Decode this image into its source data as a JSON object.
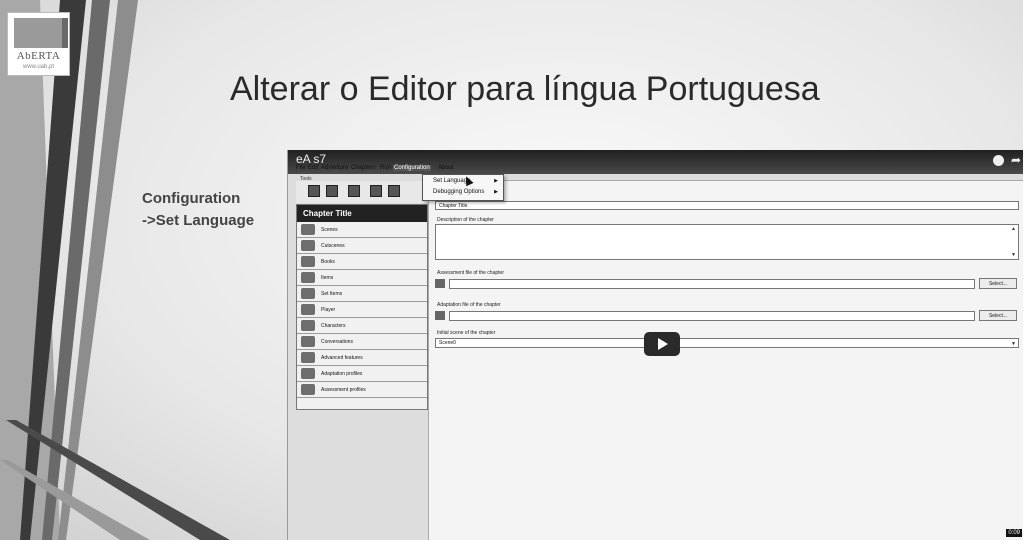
{
  "slide": {
    "title": "Alterar o Editor para língua Portuguesa",
    "steps": [
      "Configuration",
      "->Set Language"
    ]
  },
  "logo": {
    "name": "AbERTA",
    "subtitle": "www.uab.pt"
  },
  "video": {
    "title": "eA s7",
    "duration": "0:09",
    "icons": [
      "clock-icon",
      "share-icon",
      "play-icon"
    ]
  },
  "app": {
    "menu": [
      "File",
      "Edit",
      "Adventure",
      "Chapters",
      "Run",
      "Configuration",
      "About"
    ],
    "menu_selected": "Configuration",
    "dropdown": [
      "Set Language",
      "Debugging Options"
    ],
    "tools_label": "Tools",
    "panel_title": "Chapter Title",
    "nav_items": [
      {
        "label": "Scenes",
        "icon": "scenes-icon"
      },
      {
        "label": "Cutscenes",
        "icon": "cutscenes-icon"
      },
      {
        "label": "Books",
        "icon": "books-icon"
      },
      {
        "label": "Items",
        "icon": "items-icon"
      },
      {
        "label": "Set Items",
        "icon": "set-items-icon"
      },
      {
        "label": "Player",
        "icon": "player-icon"
      },
      {
        "label": "Characters",
        "icon": "characters-icon"
      },
      {
        "label": "Conversations",
        "icon": "conversations-icon"
      },
      {
        "label": "Advanced features",
        "icon": "advanced-features-icon"
      },
      {
        "label": "Adaptation profiles",
        "icon": "adaptation-profiles-icon"
      },
      {
        "label": "Assessment profiles",
        "icon": "assessment-profiles-icon"
      }
    ],
    "fields": {
      "title_value": "Chapter Title",
      "description_label": "Description of the chapter",
      "assessment_label": "Assessment file of the chapter",
      "adaptation_label": "Adaptation file of the chapter",
      "initial_scene_label": "Initial scene of the chapter",
      "initial_scene_value": "Scene0",
      "select_label": "Select..."
    }
  }
}
